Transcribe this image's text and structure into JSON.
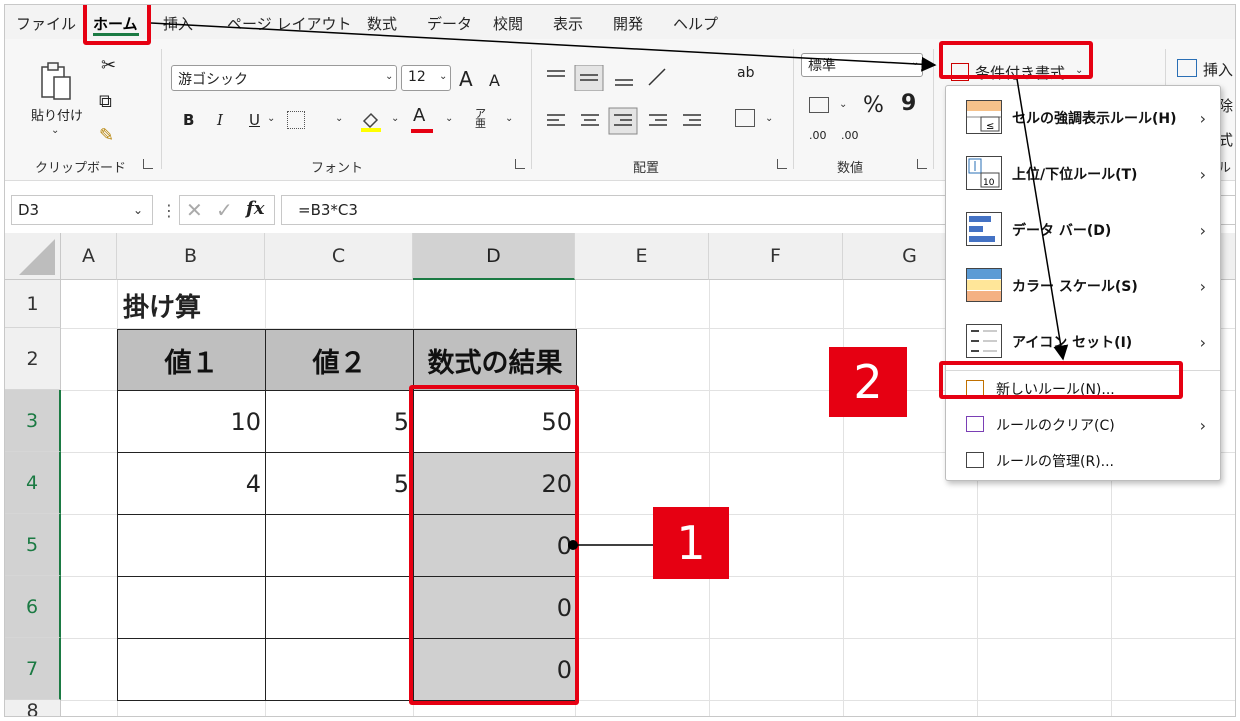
{
  "menu": {
    "items": [
      "ファイル",
      "ホーム",
      "挿入",
      "ページ レイアウト",
      "数式",
      "データ",
      "校閲",
      "表示",
      "開発",
      "ヘルプ"
    ]
  },
  "ribbon": {
    "clipboard": {
      "paste_label": "貼り付け",
      "group_label": "クリップボード"
    },
    "font": {
      "font_name": "游ゴシック",
      "font_size": "12",
      "bold": "B",
      "italic": "I",
      "underline": "U",
      "grow": "A",
      "shrink": "A",
      "font_color_letter": "A",
      "phonetic": "ア亜",
      "group_label": "フォント"
    },
    "alignment": {
      "wrap_label": "ab",
      "group_label": "配置"
    },
    "number": {
      "format_value": "標準",
      "percent": "%",
      "comma": "9",
      "dec_inc": ".00",
      "group_label": "数値"
    },
    "styles": {
      "conditional_format_label": "条件付き書式"
    },
    "cells": {
      "insert_label": "挿入",
      "delete_label": "削除",
      "format_label": "書式",
      "group_label": "セル"
    }
  },
  "formula_bar": {
    "name_box": "D3",
    "fx": "fx",
    "formula": "=B3*C3"
  },
  "sheet": {
    "columns": [
      "A",
      "B",
      "C",
      "D",
      "E",
      "F",
      "G"
    ],
    "rows": [
      "1",
      "2",
      "3",
      "4",
      "5",
      "6",
      "7",
      "8"
    ],
    "title_cell": "掛け算",
    "headers": [
      "値１",
      "値２",
      "数式の結果"
    ],
    "data": [
      [
        "10",
        "5",
        "50"
      ],
      [
        "4",
        "5",
        "20"
      ],
      [
        "",
        "",
        "0"
      ],
      [
        "",
        "",
        "0"
      ],
      [
        "",
        "",
        "0"
      ]
    ]
  },
  "dropdown": {
    "items": [
      {
        "label": "セルの強調表示ルール(H)",
        "submenu": true
      },
      {
        "label": "上位/下位ルール(T)",
        "submenu": true
      },
      {
        "label": "データ バー(D)",
        "submenu": true
      },
      {
        "label": "カラー スケール(S)",
        "submenu": true
      },
      {
        "label": "アイコン セット(I)",
        "submenu": true
      },
      {
        "label": "新しいルール(N)...",
        "submenu": false
      },
      {
        "label": "ルールのクリア(C)",
        "submenu": true
      },
      {
        "label": "ルールの管理(R)...",
        "submenu": false
      }
    ]
  },
  "annotations": {
    "badge1": "1",
    "badge2": "2"
  },
  "colors": {
    "accent_green": "#1b7a43",
    "annotation_red": "#e60012"
  }
}
